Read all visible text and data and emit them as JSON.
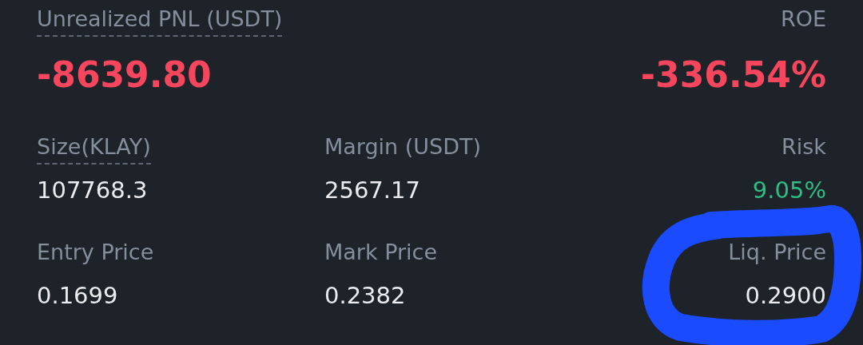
{
  "summary": [
    {
      "label": "Unrealized PNL (USDT)",
      "value": "-8639.80",
      "kind": "loss",
      "underlined": true
    },
    {
      "label": "ROE",
      "value": "-336.54%",
      "kind": "loss"
    }
  ],
  "stats": [
    {
      "label": "Size(KLAY)",
      "value": "107768.3",
      "kind": "plain",
      "underlined": true
    },
    {
      "label": "Margin (USDT)",
      "value": "2567.17",
      "kind": "plain"
    },
    {
      "label": "Risk",
      "value": "9.05%",
      "kind": "gain"
    },
    {
      "label": "Entry Price",
      "value": "0.1699",
      "kind": "plain"
    },
    {
      "label": "Mark Price",
      "value": "0.2382",
      "kind": "plain"
    },
    {
      "label": "Liq. Price",
      "value": "0.2900",
      "kind": "plain"
    }
  ]
}
